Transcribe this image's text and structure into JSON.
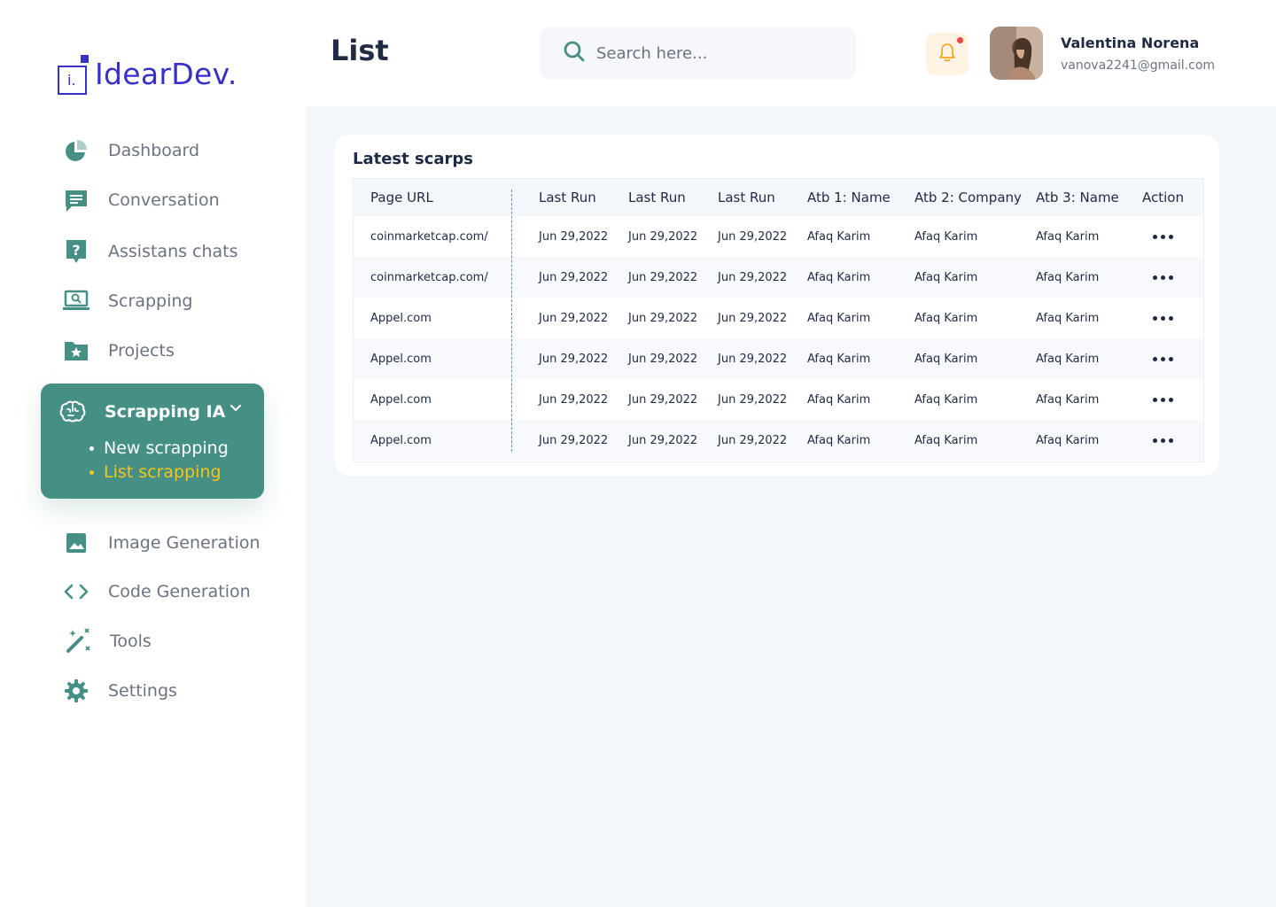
{
  "brand": {
    "logo_letter": "i.",
    "name": "IdearDev."
  },
  "sidebar": {
    "items": [
      {
        "label": "Dashboard",
        "icon": "pie-chart-icon"
      },
      {
        "label": "Conversation",
        "icon": "chat-icon"
      },
      {
        "label": "Assistans chats",
        "icon": "question-chat-icon"
      },
      {
        "label": "Scrapping",
        "icon": "laptop-search-icon"
      },
      {
        "label": "Projects",
        "icon": "folder-star-icon"
      }
    ],
    "active_group": {
      "label": "Scrapping IA",
      "icon": "brain-icon",
      "children": [
        {
          "label": "New scrapping",
          "active": false
        },
        {
          "label": "List scrapping",
          "active": true
        }
      ]
    },
    "items_after": [
      {
        "label": "Image Generation",
        "icon": "image-icon"
      },
      {
        "label": "Code Generation",
        "icon": "code-icon"
      },
      {
        "label": "Tools",
        "icon": "magic-wand-icon"
      },
      {
        "label": "Settings",
        "icon": "gear-icon"
      }
    ]
  },
  "header": {
    "title": "List",
    "search_placeholder": "Search here...",
    "notifications": {
      "has_unread": true
    },
    "user": {
      "name": "Valentina Norena",
      "email": "vanova2241@gmail.com"
    }
  },
  "card": {
    "title": "Latest scarps",
    "columns": [
      "Page URL",
      "Last Run",
      "Last Run",
      "Last Run",
      "Atb 1: Name",
      "Atb 2: Company",
      "Atb 3: Name",
      "Action"
    ],
    "rows": [
      [
        "coinmarketcap.com/",
        "Jun 29,2022",
        "Jun 29,2022",
        "Jun 29,2022",
        "Afaq Karim",
        "Afaq Karim",
        "Afaq Karim"
      ],
      [
        "coinmarketcap.com/",
        "Jun 29,2022",
        "Jun 29,2022",
        "Jun 29,2022",
        "Afaq Karim",
        "Afaq Karim",
        "Afaq Karim"
      ],
      [
        "Appel.com",
        "Jun 29,2022",
        "Jun 29,2022",
        "Jun 29,2022",
        "Afaq Karim",
        "Afaq Karim",
        "Afaq Karim"
      ],
      [
        "Appel.com",
        "Jun 29,2022",
        "Jun 29,2022",
        "Jun 29,2022",
        "Afaq Karim",
        "Afaq Karim",
        "Afaq Karim"
      ],
      [
        "Appel.com",
        "Jun 29,2022",
        "Jun 29,2022",
        "Jun 29,2022",
        "Afaq Karim",
        "Afaq Karim",
        "Afaq Karim"
      ],
      [
        "Appel.com",
        "Jun 29,2022",
        "Jun 29,2022",
        "Jun 29,2022",
        "Afaq Karim",
        "Afaq Karim",
        "Afaq Karim"
      ]
    ],
    "action_icon": "more-horizontal-icon"
  },
  "colors": {
    "brand": "#3730c9",
    "primary": "#468f84",
    "icon": "#468f84",
    "active_sub": "#f5c518",
    "badge": "#ef4444",
    "bell": "#f5a623"
  }
}
